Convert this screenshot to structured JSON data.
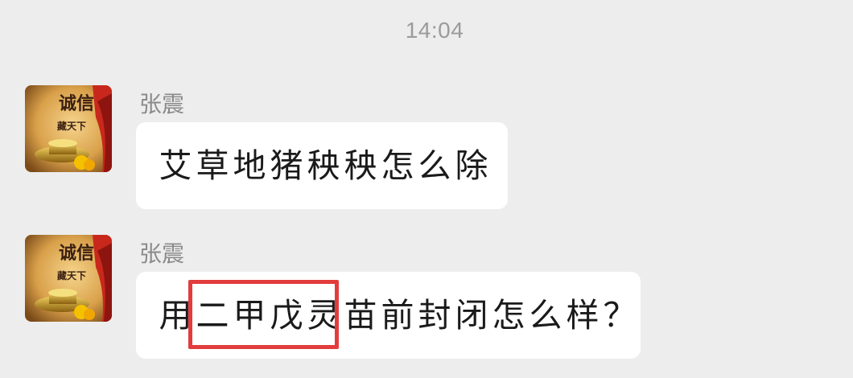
{
  "timestamp": "14:04",
  "messages": [
    {
      "sender": "张震",
      "text": "艾草地猪秧秧怎么除",
      "chars": [
        "艾",
        "草",
        "地",
        "猪",
        "秧",
        "秧",
        "怎",
        "么",
        "除"
      ]
    },
    {
      "sender": "张震",
      "text": "用二甲戊灵苗前封闭怎么样？",
      "chars": [
        "用",
        "二",
        "甲",
        "戊",
        "灵",
        "苗",
        "前",
        "封",
        "闭",
        "怎",
        "么",
        "样",
        "？"
      ],
      "highlighted_text": "二甲戊灵"
    }
  ],
  "avatar": {
    "text_line1": "诚信",
    "text_line2": "藏天下"
  },
  "colors": {
    "background": "#ededed",
    "bubble": "#ffffff",
    "timestamp": "#9b9b9b",
    "sender": "#8a8a8a",
    "highlight_border": "#e23c3c"
  }
}
